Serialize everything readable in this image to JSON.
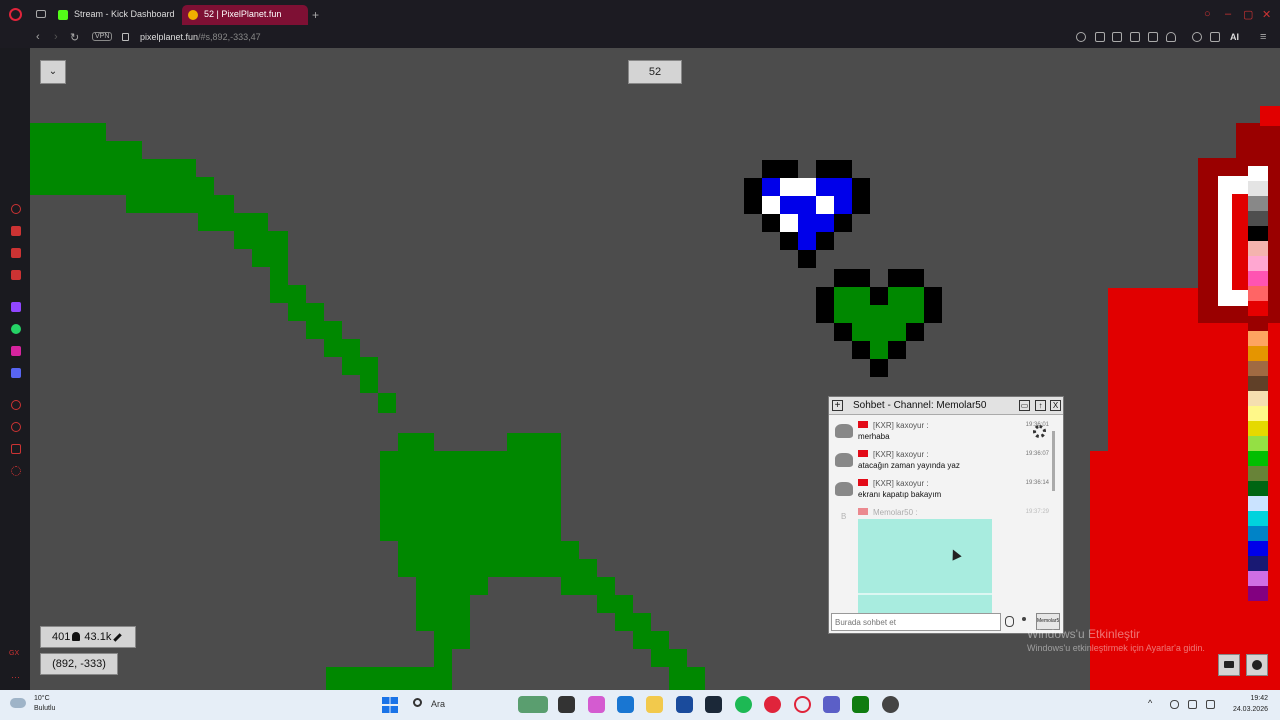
{
  "browser": {
    "tabs": [
      {
        "label": "Stream - Kick Dashboard"
      },
      {
        "label": "52 | PixelPlanet.fun"
      }
    ],
    "new_tab": "+",
    "vpn_badge": "VPN",
    "url_host": "pixelplanet.fun",
    "url_path": "/#s,892,-333,47",
    "ai_label": "AI"
  },
  "canvas_ui": {
    "dropdown_label": "⌄",
    "online_count": "52",
    "stat_online": "401",
    "stat_pixels": "43.1k",
    "coordinates": "(892, -333)",
    "palette_colors": [
      "#ffffff",
      "#e4e4e4",
      "#888888",
      "#4e4e4e",
      "#000000",
      "#f4b3ae",
      "#ffa7d1",
      "#ff54b2",
      "#ff6565",
      "#e50000",
      "#9a0000",
      "#fea460",
      "#e59500",
      "#a06a42",
      "#604028",
      "#f5dfb0",
      "#fff889",
      "#e5d900",
      "#94e044",
      "#02be01",
      "#688338",
      "#006513",
      "#cae3ff",
      "#00d3dd",
      "#0083c7",
      "#0000ea",
      "#191973",
      "#cf6ee4",
      "#820080"
    ]
  },
  "chat": {
    "title": "Sohbet - Channel: Memolar50",
    "messages": [
      {
        "name": "[KXR] kaxoyur :",
        "text": "merhaba",
        "time": "19:36:01"
      },
      {
        "name": "[KXR] kaxoyur :",
        "text": "atacağın zaman yayında yaz",
        "time": "19:36:07"
      },
      {
        "name": "[KXR] kaxoyur :",
        "text": "ekranı kapatıp bakayım",
        "time": "19:36:14"
      },
      {
        "name": "Memolar50 :",
        "text": "",
        "time": "19:37:29",
        "avatar_letter": "B"
      }
    ],
    "input_placeholder": "Burada sohbet et",
    "channel_select": "Memolar50"
  },
  "watermark": {
    "line1": "Windows'u Etkinleştir",
    "line2": "Windows'u etkinleştirmek için Ayarlar'a gidin."
  },
  "taskbar": {
    "temperature": "10°C",
    "condition": "Bulutlu",
    "search": "Ara",
    "time": "19:42",
    "date": "24.03.2026"
  }
}
